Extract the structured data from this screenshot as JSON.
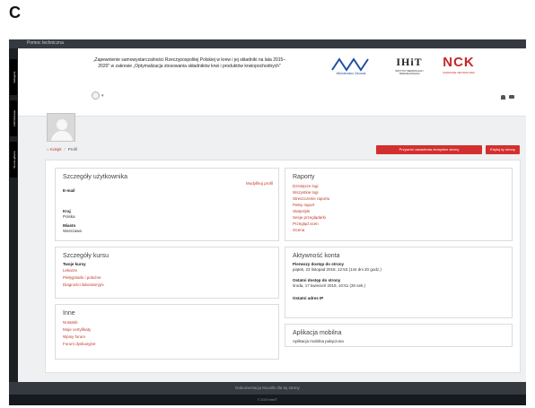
{
  "panel_letter": "C",
  "topbar": {
    "text": "Pomoc techniczna"
  },
  "sidebar": {
    "tabs": [
      "Kategorie",
      "Administracja",
      "Strona główna"
    ]
  },
  "header": {
    "title_line1": "„Zapewnienie samowystarczalności Rzeczypospolitej Polskiej w krew i jej składniki na lata 2015–",
    "title_line2": "2020” w zakresie „Optymalizacja stosowania składników krwi i produktów krwiopochodnych”",
    "logo_mz_text": "Ministerstwo Zdrowia",
    "logo_iht_text": "IHiT",
    "logo_iht_sub": "INSTYTUT HEMATOLOGII I TRANSFUZJOLOGII",
    "logo_nck_text": "NCK",
    "logo_nck_sub": "NARODOWE CENTRUM KRWI"
  },
  "user_menu": {
    "caret": "▾"
  },
  "breadcrumb": {
    "home": "Kokpit",
    "current": "Profil"
  },
  "buttons": {
    "reset": "Przywróć ustawienia domyślne strony",
    "edit": "Edytuj tę stronę"
  },
  "user_details": {
    "title": "Szczegóły użytkownika",
    "edit_link": "Modyfikuj profil",
    "email_label": "E-mail",
    "country_label": "Kraj",
    "country_value": "Polska",
    "city_label": "Miasto",
    "city_value": "Warszawa"
  },
  "reports": {
    "title": "Raporty",
    "items": [
      "Dzisiejsze logi",
      "Wszystkie logi",
      "Streszczenie raportu",
      "Pełny raport",
      "Statystyki",
      "Sesje przeglądarki",
      "Przegląd ocen",
      "Ocena"
    ]
  },
  "course_details": {
    "title": "Szczegóły kursu",
    "my_courses_label": "Twoje kursy",
    "items": [
      "Lekarze",
      "Pielęgniarki i położne",
      "Diagności laboratoryjni"
    ]
  },
  "account_activity": {
    "title": "Aktywność konta",
    "first_access_label": "Pierwszy dostęp do strony",
    "first_access_value": "piątek, 23 listopad 2018, 12:53  (144 dni 20 godz.)",
    "last_access_label": "Ostatni dostęp do strony",
    "last_access_value": "środa, 17 kwiecień 2019, 10:51  (30 sek.)",
    "last_ip_label": "Ostatni adres IP"
  },
  "misc": {
    "title": "Inne",
    "items": [
      "Notatnik",
      "Moje certyfikaty",
      "Wpisy forum",
      "Forum dyskusyjne"
    ]
  },
  "mobile_app": {
    "title": "Aplikacja mobilna",
    "status": "Aplikacja mobilna połączona"
  },
  "footer": {
    "doc_link": "Dokumentacja Moodle dla tej strony",
    "copyright": "© 2019 IntelIT"
  },
  "colors": {
    "accent": "#d32f2f",
    "link": "#c0392b",
    "dark_bar": "#343a40"
  }
}
